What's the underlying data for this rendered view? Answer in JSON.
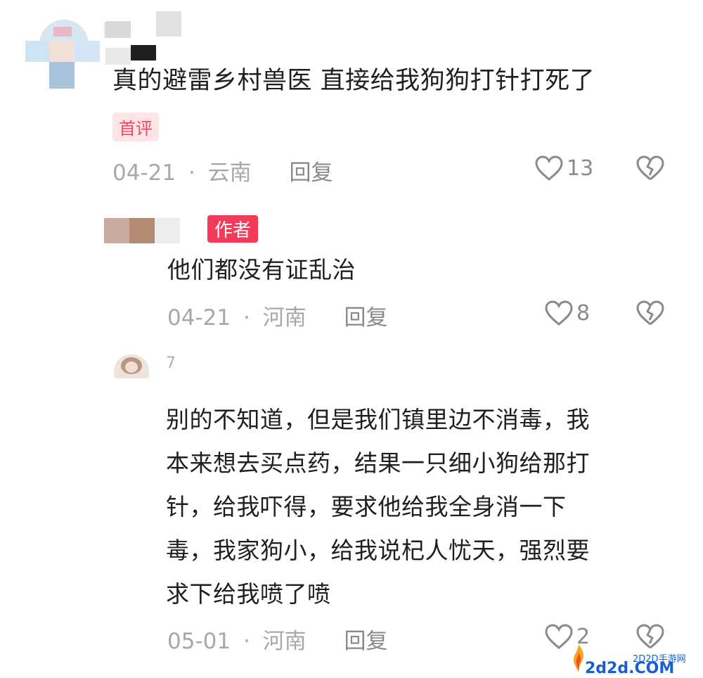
{
  "comments": [
    {
      "text": "真的避雷乡村兽医 直接给我狗狗打针打死了",
      "badge": "首评",
      "date": "04-21",
      "location": "云南",
      "reply": "回复",
      "likes": "13"
    },
    {
      "author_badge": "作者",
      "text": "他们都没有证乱治",
      "date": "04-21",
      "location": "河南",
      "reply": "回复",
      "likes": "8"
    },
    {
      "username_fragment": "7",
      "text_lines": [
        "别的不知道，但是我们镇里边不消毒，我",
        "本来想去买点药，结果一只细小狗给那打",
        "针，给我吓得，要求他给我全身消一下",
        "毒，我家狗小，给我说杞人忧天，强烈要",
        "求下给我喷了喷"
      ],
      "date": "05-01",
      "location": "河南",
      "reply": "回复",
      "likes": "2"
    }
  ],
  "separator": "·",
  "watermark": {
    "small": "2D2D手游网",
    "large": "2d2d.COM"
  },
  "colors": {
    "badge_bg": "#fde4e7",
    "badge_text": "#f04b63",
    "meta": "#a8a8a8",
    "watermark_blue": "#1a5fd0"
  }
}
